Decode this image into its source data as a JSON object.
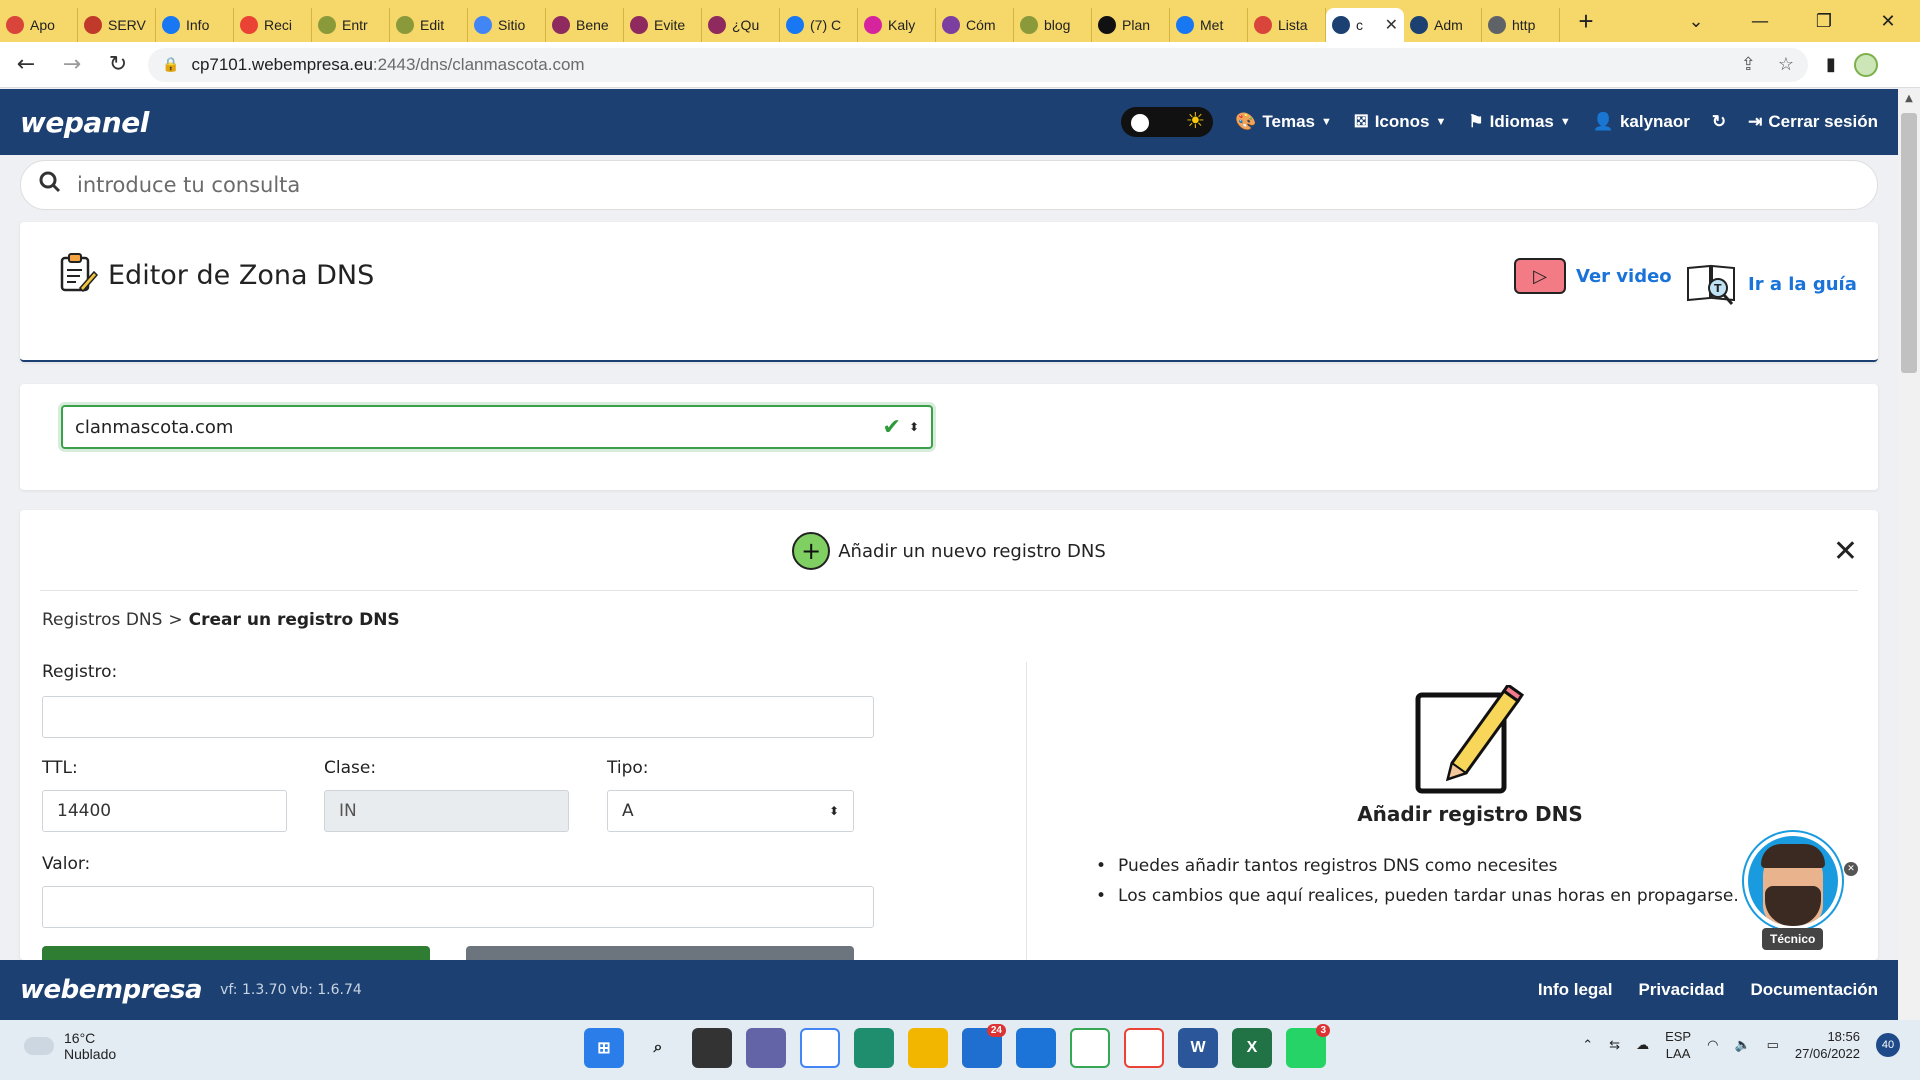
{
  "browser": {
    "tabs": [
      {
        "label": "Apo",
        "color": "#d9453a"
      },
      {
        "label": "SERV",
        "color": "#c0392b"
      },
      {
        "label": "Info",
        "color": "#1877f2"
      },
      {
        "label": "Reci",
        "color": "#ea4335"
      },
      {
        "label": "Entr",
        "color": "#8a9a3a"
      },
      {
        "label": "Edit",
        "color": "#8a9a3a"
      },
      {
        "label": "Sitio",
        "color": "#4285f4"
      },
      {
        "label": "Bene",
        "color": "#8e2a5e"
      },
      {
        "label": "Evite",
        "color": "#8e2a5e"
      },
      {
        "label": "¿Qu",
        "color": "#8e2a5e"
      },
      {
        "label": "(7) C",
        "color": "#1877f2"
      },
      {
        "label": "Kaly",
        "color": "#d6249f"
      },
      {
        "label": "Cóm",
        "color": "#7b3fa0"
      },
      {
        "label": "blog",
        "color": "#8a9a3a"
      },
      {
        "label": "Plan",
        "color": "#111111"
      },
      {
        "label": "Met",
        "color": "#1877f2"
      },
      {
        "label": "Lista",
        "color": "#d9453a"
      },
      {
        "label": "c",
        "color": "#1c4071",
        "active": true
      },
      {
        "label": "Adm",
        "color": "#1c4071"
      },
      {
        "label": "http",
        "color": "#5f6368"
      }
    ],
    "url_host": "cp7101.webempresa.eu",
    "url_path": ":2443/dns/clanmascota.com"
  },
  "header": {
    "brand": "wepanel",
    "menus": [
      {
        "icon": "palette-icon",
        "label": "Temas",
        "caret": true
      },
      {
        "icon": "icons-icon",
        "label": "Iconos",
        "caret": true
      },
      {
        "icon": "flag-icon",
        "label": "Idiomas",
        "caret": true
      },
      {
        "icon": "user-gear-icon",
        "label": "kalynaor",
        "caret": false
      },
      {
        "icon": "refresh-icon",
        "label": "",
        "caret": false
      },
      {
        "icon": "logout-icon",
        "label": "Cerrar sesión",
        "caret": false
      }
    ]
  },
  "search": {
    "placeholder": "introduce tu consulta"
  },
  "title_card": {
    "title": "Editor de Zona DNS",
    "video_label": "Ver video",
    "guide_label": "Ir a la guía"
  },
  "domain_select": {
    "value": "clanmascota.com"
  },
  "form": {
    "heading": "Añadir un nuevo registro DNS",
    "breadcrumb_root": "Registros DNS",
    "breadcrumb_sep": ">",
    "breadcrumb_current": "Crear un registro DNS",
    "registro_label": "Registro:",
    "registro_value": "",
    "ttl_label": "TTL:",
    "ttl_value": "14400",
    "clase_label": "Clase:",
    "clase_value": "IN",
    "tipo_label": "Tipo:",
    "tipo_value": "A",
    "valor_label": "Valor:",
    "valor_value": "",
    "info_title": "Añadir registro DNS",
    "info_items": [
      "Puedes añadir tantos registros DNS como necesites",
      "Los cambios que aquí realices, pueden tardar unas horas en propagarse."
    ],
    "colors": {
      "primary_button": "#2e7d32",
      "secondary_button": "#6c757d"
    }
  },
  "chat": {
    "tag": "Técnico"
  },
  "footer": {
    "brand": "webempresa",
    "version": "vf: 1.3.70 vb: 1.6.74",
    "links": [
      "Info legal",
      "Privacidad",
      "Documentación"
    ]
  },
  "taskbar": {
    "temperature": "16°C",
    "weather": "Nublado",
    "lang_top": "ESP",
    "lang_bottom": "LAA",
    "time": "18:56",
    "date": "27/06/2022",
    "notifications": "40",
    "mail_badge": "24",
    "whatsapp_badge": "3"
  }
}
